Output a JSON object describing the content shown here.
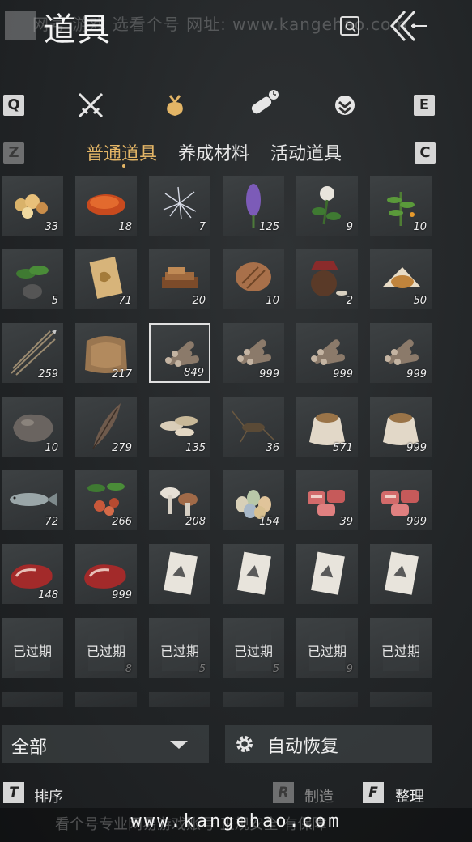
{
  "header": {
    "title": "道具",
    "watermark_top": "网号 游戏 选看个号   网址: www.kangehao.com"
  },
  "category_keys": {
    "left": "Q",
    "right": "E"
  },
  "sub_keys": {
    "left": "Z",
    "right": "C"
  },
  "categories": [
    {
      "icon": "crossed-swords-icon"
    },
    {
      "icon": "pouch-icon",
      "active": true
    },
    {
      "icon": "scroll-clock-icon"
    },
    {
      "icon": "badge-icon"
    }
  ],
  "subtabs": [
    "普通道具",
    "养成材料",
    "活动道具"
  ],
  "active_subtab": 0,
  "items": [
    {
      "icon": "food-chunks",
      "qty": "33"
    },
    {
      "icon": "fried-cake",
      "qty": "18"
    },
    {
      "icon": "white-flower",
      "qty": "7"
    },
    {
      "icon": "purple-herb",
      "qty": "125"
    },
    {
      "icon": "white-blossom",
      "qty": "9"
    },
    {
      "icon": "green-herb",
      "qty": "10"
    },
    {
      "icon": "potted-plant",
      "qty": "5"
    },
    {
      "icon": "gold-paper",
      "qty": "71"
    },
    {
      "icon": "tea-bricks",
      "qty": "20"
    },
    {
      "icon": "wooden-comb",
      "qty": "10"
    },
    {
      "icon": "wine-jar",
      "qty": "2"
    },
    {
      "icon": "grain-pile",
      "qty": "50"
    },
    {
      "icon": "arrows",
      "qty": "259"
    },
    {
      "icon": "fur-pelt",
      "qty": "217"
    },
    {
      "icon": "firewood",
      "qty": "849",
      "selected": true
    },
    {
      "icon": "firewood",
      "qty": "999"
    },
    {
      "icon": "firewood",
      "qty": "999"
    },
    {
      "icon": "firewood",
      "qty": "999"
    },
    {
      "icon": "ore-stone",
      "qty": "10"
    },
    {
      "icon": "feather",
      "qty": "279"
    },
    {
      "icon": "mushrooms",
      "qty": "135"
    },
    {
      "icon": "cricket",
      "qty": "36"
    },
    {
      "icon": "grain-sack",
      "qty": "571"
    },
    {
      "icon": "grain-sack",
      "qty": "999"
    },
    {
      "icon": "fish",
      "qty": "72"
    },
    {
      "icon": "red-fruit",
      "qty": "266"
    },
    {
      "icon": "white-mushrooms",
      "qty": "208"
    },
    {
      "icon": "eggs",
      "qty": "154"
    },
    {
      "icon": "raw-meat",
      "qty": "39"
    },
    {
      "icon": "raw-meat",
      "qty": "999"
    },
    {
      "icon": "steak",
      "qty": "148"
    },
    {
      "icon": "steak",
      "qty": "999"
    },
    {
      "icon": "recipe-card",
      "qty": ""
    },
    {
      "icon": "recipe-card",
      "qty": ""
    },
    {
      "icon": "recipe-card",
      "qty": ""
    },
    {
      "icon": "recipe-card",
      "qty": ""
    },
    {
      "icon": "expired-item",
      "expired": "已过期",
      "qty": ""
    },
    {
      "icon": "expired-item",
      "expired": "已过期",
      "qty": "8"
    },
    {
      "icon": "expired-item",
      "expired": "已过期",
      "qty": "5"
    },
    {
      "icon": "expired-item",
      "expired": "已过期",
      "qty": "5"
    },
    {
      "icon": "expired-item",
      "expired": "已过期",
      "qty": "9"
    },
    {
      "icon": "expired-item",
      "expired": "已过期",
      "qty": ""
    }
  ],
  "bottom": {
    "filter_label": "全部",
    "auto_restore_label": "自动恢复",
    "sort": {
      "key": "T",
      "label": "排序"
    },
    "craft": {
      "key": "R",
      "label": "制造"
    },
    "organize": {
      "key": "F",
      "label": "整理"
    }
  },
  "watermark_bottom": {
    "text": "看个号专业网易游戏账号   正规安全   有保障",
    "url": "www.kangehao.com"
  },
  "colors": {
    "accent_gold": "#e3b566",
    "slot_bg": "#35393b",
    "background": "#222527"
  }
}
